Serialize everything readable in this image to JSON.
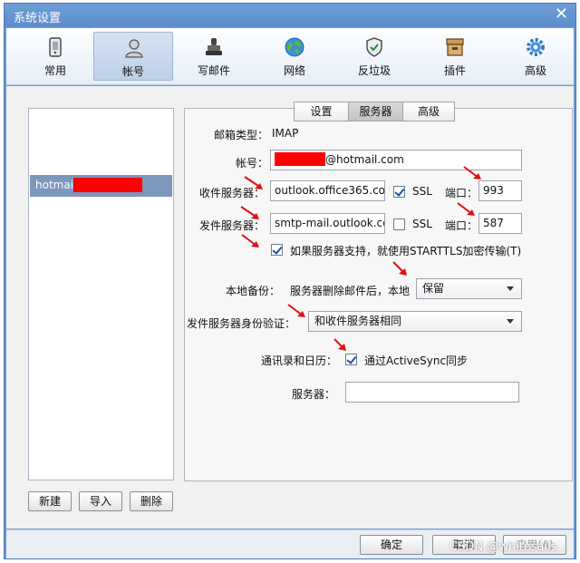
{
  "window": {
    "title": "系统设置",
    "close_symbol": "✕"
  },
  "toolbar": {
    "items": [
      {
        "label": "常用",
        "icon": "settings-phone-icon"
      },
      {
        "label": "帐号",
        "icon": "user-icon"
      },
      {
        "label": "写邮件",
        "icon": "stamp-icon"
      },
      {
        "label": "网络",
        "icon": "globe-icon"
      },
      {
        "label": "反垃圾",
        "icon": "shield-icon"
      },
      {
        "label": "插件",
        "icon": "box-icon"
      },
      {
        "label": "高级",
        "icon": "gear-icon"
      }
    ],
    "active_index": 1
  },
  "accounts": {
    "items": [
      {
        "name": "hotmai"
      }
    ]
  },
  "left_buttons": {
    "new": "新建",
    "import": "导入",
    "delete": "删除"
  },
  "tabs": [
    {
      "label": "设置"
    },
    {
      "label": "服务器"
    },
    {
      "label": "高级"
    }
  ],
  "form": {
    "mailbox_type_label": "邮箱类型：",
    "mailbox_type_value": "IMAP",
    "account_label": "帐号：",
    "account_value": "@hotmail.com",
    "incoming_label": "收件服务器：",
    "incoming_value": "outlook.office365.co",
    "incoming_ssl_label": "SSL",
    "incoming_port_label": "端口：",
    "incoming_port_value": "993",
    "outgoing_label": "发件服务器：",
    "outgoing_value": "smtp-mail.outlook.cc",
    "outgoing_ssl_label": "SSL",
    "outgoing_port_label": "端口：",
    "outgoing_port_value": "587",
    "starttls_label": "如果服务器支持，就使用STARTTLS加密传输(T)",
    "backup_label": "本地备份：",
    "backup_desc": "服务器删除邮件后，本地",
    "backup_value": "保留",
    "auth_label": "发件服务器身份验证：",
    "auth_value": "和收件服务器相同",
    "contacts_label": "通讯录和日历：",
    "activesync_label": "通过ActiveSync同步",
    "server_label": "服务器：",
    "server_value": ""
  },
  "footer": {
    "ok": "确定",
    "cancel": "取消",
    "apply": "应用(A)"
  },
  "watermark": "CSDN @whitesails",
  "colors": {
    "titlebar": "#5c8ccb",
    "redaction": "#ff0000",
    "arrow": "#e01010",
    "selection": "#7b97bb"
  }
}
